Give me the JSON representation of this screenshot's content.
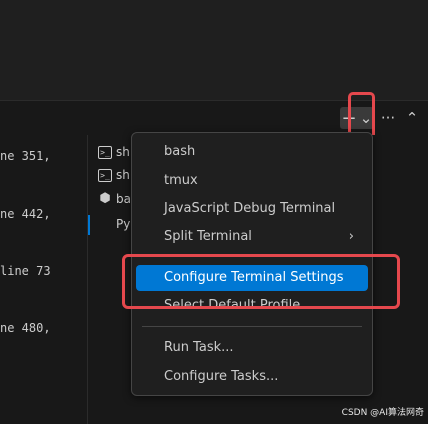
{
  "toolbar": {
    "new_terminal_icon": "+",
    "launch_profile_icon": "⌄",
    "more_icon": "···",
    "maximize_icon": "⌃"
  },
  "terminal_lines": [
    "ne 351,",
    "ne 442,",
    "line 73",
    "ne 480,"
  ],
  "tabs": [
    {
      "icon": ">_",
      "label": "sh"
    },
    {
      "icon": ">_",
      "label": "sh"
    },
    {
      "icon": "⬢",
      "label": "ba"
    },
    {
      "icon": "",
      "label": "Py"
    }
  ],
  "menu": {
    "items": [
      {
        "label": "bash"
      },
      {
        "label": "tmux"
      },
      {
        "label": "JavaScript Debug Terminal"
      },
      {
        "label": "Split Terminal",
        "arrow": "›"
      },
      {
        "label": "Configure Terminal Settings"
      },
      {
        "label": "Select Default Profile"
      },
      {
        "label": "Run Task..."
      },
      {
        "label": "Configure Tasks..."
      }
    ]
  },
  "watermark": "CSDN @AI算法网奇"
}
